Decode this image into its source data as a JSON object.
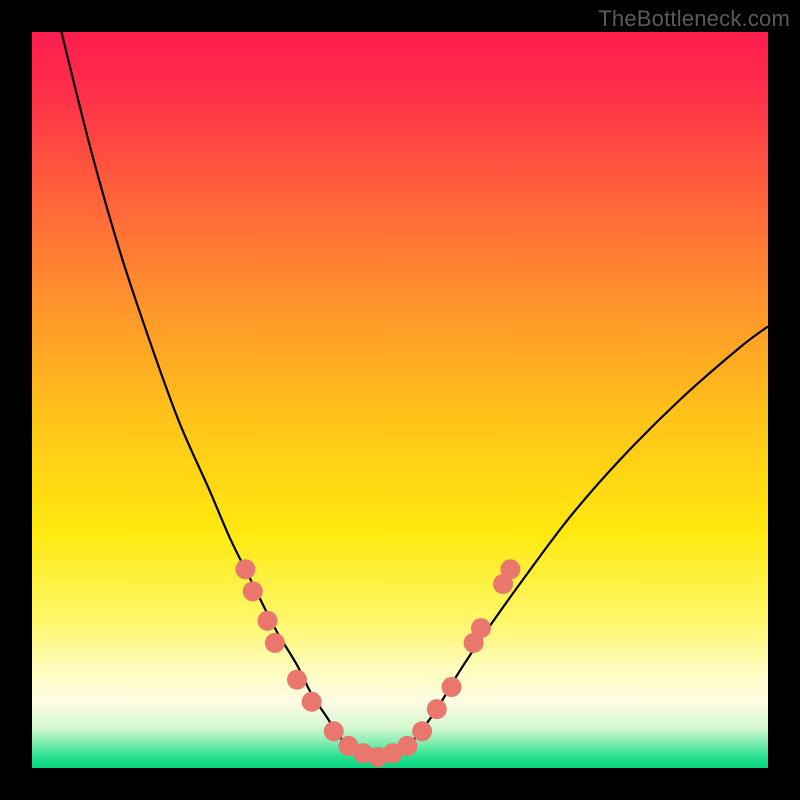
{
  "watermark": "TheBottleneck.com",
  "chart_data": {
    "type": "line",
    "title": "",
    "xlabel": "",
    "ylabel": "",
    "xlim": [
      0,
      100
    ],
    "ylim": [
      0,
      100
    ],
    "background": {
      "stops": [
        {
          "offset": 0.0,
          "color": "#ff1d4e"
        },
        {
          "offset": 0.08,
          "color": "#ff2e4a"
        },
        {
          "offset": 0.2,
          "color": "#ff5a3d"
        },
        {
          "offset": 0.35,
          "color": "#ff8d2e"
        },
        {
          "offset": 0.52,
          "color": "#ffc21a"
        },
        {
          "offset": 0.68,
          "color": "#ffe90f"
        },
        {
          "offset": 0.8,
          "color": "#fff76a"
        },
        {
          "offset": 0.86,
          "color": "#fffbb6"
        },
        {
          "offset": 0.91,
          "color": "#fdfde4"
        },
        {
          "offset": 0.945,
          "color": "#d6f8cf"
        },
        {
          "offset": 0.965,
          "color": "#84edb2"
        },
        {
          "offset": 0.985,
          "color": "#26e08e"
        },
        {
          "offset": 1.0,
          "color": "#08d57f"
        }
      ]
    },
    "series": [
      {
        "name": "bottleneck-curve",
        "stroke": "#000000",
        "stroke_width": 2.2,
        "x": [
          4,
          8,
          12,
          16,
          20,
          24,
          27,
          30,
          33,
          36,
          38,
          40,
          42,
          44,
          46,
          48,
          50,
          52,
          55,
          58,
          62,
          67,
          73,
          80,
          88,
          96,
          100
        ],
        "values": [
          100,
          84,
          70,
          58,
          47,
          38,
          31,
          25,
          19,
          14,
          10,
          7,
          4,
          2,
          1,
          1,
          2,
          4,
          8,
          13,
          19,
          26,
          34,
          42,
          50,
          57,
          60
        ]
      }
    ],
    "markers": {
      "color": "#e9776e",
      "radius": 10,
      "points": [
        {
          "x": 29,
          "y": 27
        },
        {
          "x": 30,
          "y": 24
        },
        {
          "x": 32,
          "y": 20
        },
        {
          "x": 33,
          "y": 17
        },
        {
          "x": 36,
          "y": 12
        },
        {
          "x": 38,
          "y": 9
        },
        {
          "x": 41,
          "y": 5
        },
        {
          "x": 43,
          "y": 3
        },
        {
          "x": 45,
          "y": 2
        },
        {
          "x": 47,
          "y": 1.5
        },
        {
          "x": 49,
          "y": 2
        },
        {
          "x": 51,
          "y": 3
        },
        {
          "x": 53,
          "y": 5
        },
        {
          "x": 55,
          "y": 8
        },
        {
          "x": 57,
          "y": 11
        },
        {
          "x": 60,
          "y": 17
        },
        {
          "x": 61,
          "y": 19
        },
        {
          "x": 64,
          "y": 25
        },
        {
          "x": 65,
          "y": 27
        }
      ]
    }
  }
}
